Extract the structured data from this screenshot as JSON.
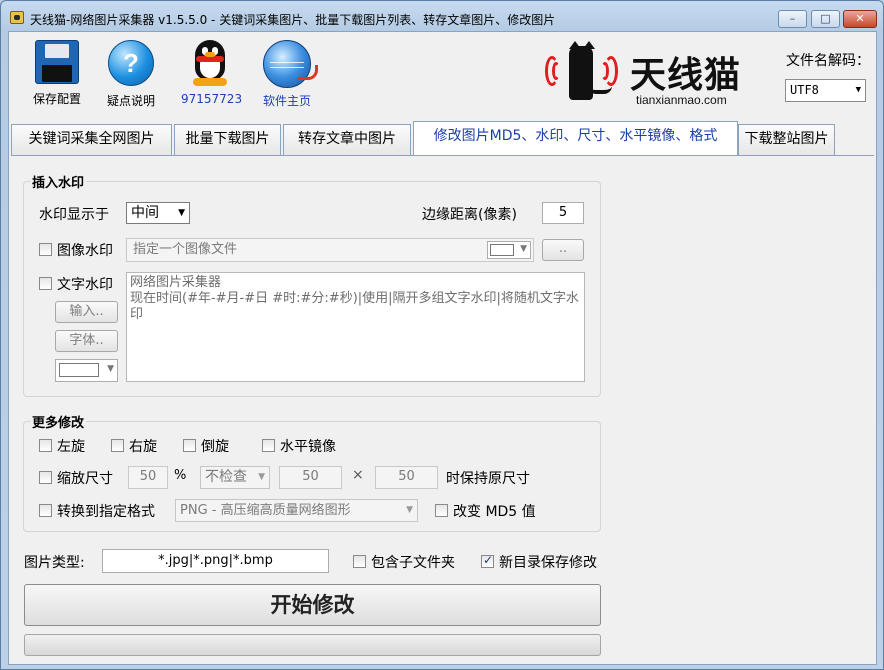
{
  "window": {
    "title": "天线猫-网络图片采集器 v1.5.5.0 - 关键词采集图片、批量下载图片列表、转存文章图片、修改图片",
    "min_label": "–",
    "max_label": "□",
    "close_label": "✕"
  },
  "toolbar": {
    "save_label": "保存配置",
    "help_label": "疑点说明",
    "qq_label": "97157723",
    "home_label": "软件主页"
  },
  "logo": {
    "brand": "天线猫",
    "domain": "tianxianmao.com"
  },
  "decode": {
    "label": "文件名解码：",
    "value": "UTF8"
  },
  "tabs": [
    {
      "label": "关键词采集全网图片"
    },
    {
      "label": "批量下载图片"
    },
    {
      "label": "转存文章中图片"
    },
    {
      "label": "修改图片MD5、水印、尺寸、水平镜像、格式"
    },
    {
      "label": "下载整站图片"
    }
  ],
  "watermark": {
    "legend": "插入水印",
    "position_label": "水印显示于",
    "position_value": "中间",
    "margin_label": "边缘距离(像素)",
    "margin_value": "5",
    "image_check_label": "图像水印",
    "image_placeholder": "指定一个图像文件",
    "browse_label": "..",
    "text_check_label": "文字水印",
    "text_content": "网络图片采集器\n现在时间(#年-#月-#日 #时:#分:#秒)|使用|隔开多组文字水印|将随机文字水印",
    "input_button": "输入..",
    "font_button": "字体.."
  },
  "more": {
    "legend": "更多修改",
    "rotate_left": "左旋",
    "rotate_right": "右旋",
    "flip": "倒旋",
    "mirror": "水平镜像",
    "scale_label": "缩放尺寸",
    "scale_value": "50",
    "percent": "%",
    "check_select": "不检查",
    "width_value": "50",
    "times": "×",
    "height_value": "50",
    "keep_label": "时保持原尺寸",
    "convert_label": "转换到指定格式",
    "format_value": "PNG -  高压缩高质量网络图形",
    "md5_label": "改变 MD5 值"
  },
  "bottom": {
    "type_label": "图片类型:",
    "type_value": "*.jpg|*.png|*.bmp",
    "subfolder_label": "包含子文件夹",
    "newdir_label": "新目录保存修改",
    "newdir_checked": true,
    "start_label": "开始修改"
  }
}
